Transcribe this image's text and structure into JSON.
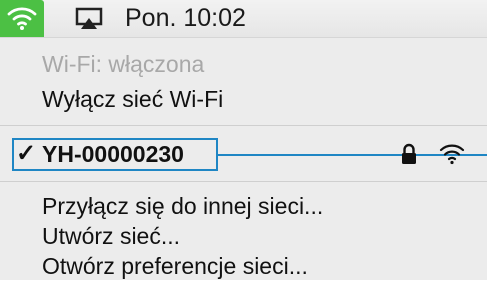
{
  "menubar": {
    "clock": "Pon. 10:02",
    "wifi_icon": "wifi-icon",
    "airplay_icon": "airplay-icon",
    "accent_color": "#4cc044"
  },
  "menu": {
    "wifi_status": "Wi-Fi: włączona",
    "turn_off_wifi": "Wyłącz sieć Wi-Fi",
    "networks": [
      {
        "name": "YH-00000230",
        "connected": true,
        "check": "✓",
        "secured_icon": "lock-icon",
        "signal_icon": "wifi-signal-icon"
      }
    ],
    "join_other": "Przyłącz się do innej sieci...",
    "create_network": "Utwórz sieć...",
    "open_preferences": "Otwórz preferencje sieci..."
  },
  "annotation": {
    "highlight_color": "#1f86c4"
  }
}
